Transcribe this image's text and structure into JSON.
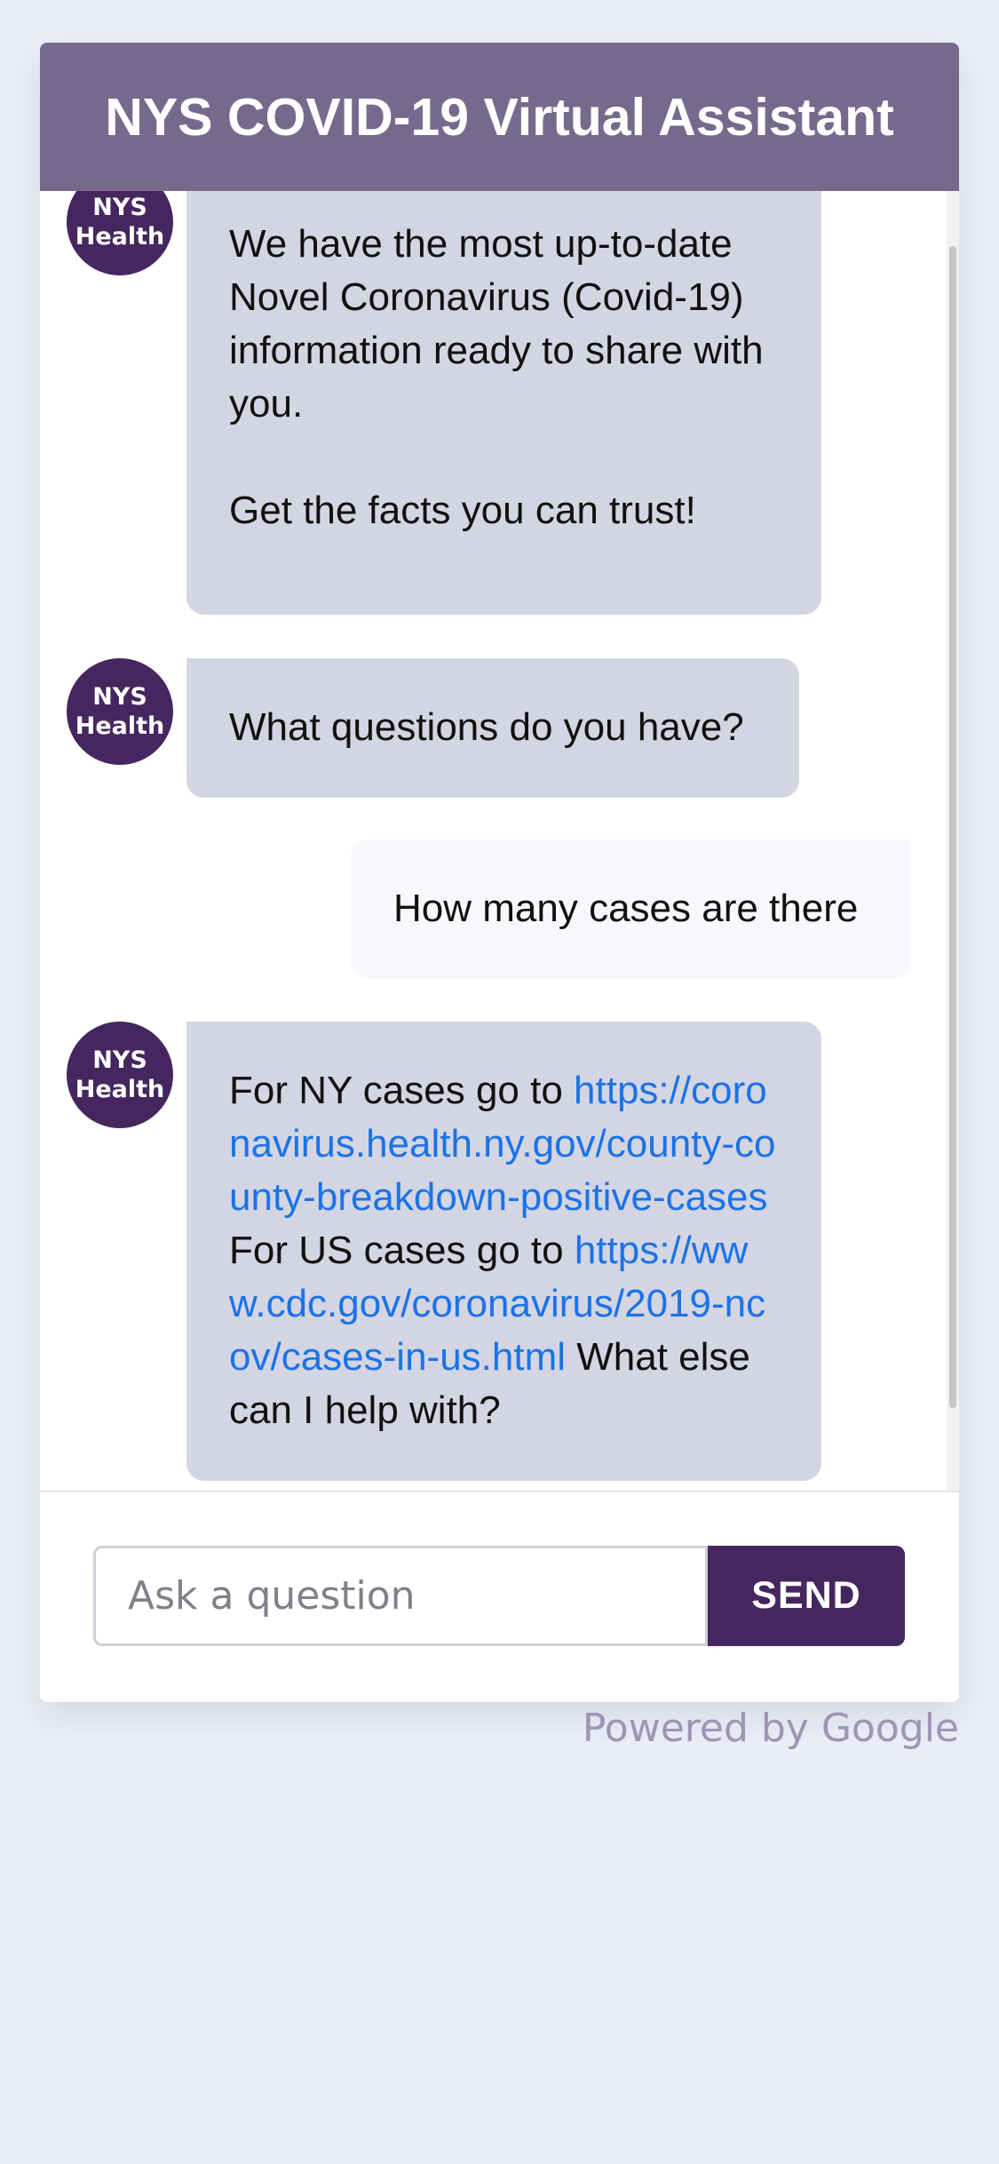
{
  "header": {
    "title": "NYS COVID-19 Virtual Assistant"
  },
  "avatar": {
    "line1": "NYS",
    "line2": "Health"
  },
  "messages": [
    {
      "from": "bot",
      "text1": "We have the most up-to-date Novel Coronavirus (Covid-19) information ready to share with you.",
      "text2": "Get the facts you can trust!"
    },
    {
      "from": "bot",
      "text": "What questions do you have?"
    },
    {
      "from": "user",
      "text": "How many cases are there"
    },
    {
      "from": "bot",
      "part1": "For NY cases go to ",
      "link1": "https://coronavirus.health.ny.gov/county-county-breakdown-positive-cases",
      "part2": " For US cases go to ",
      "link2": "https://www.cdc.gov/coronavirus/2019-ncov/cases-in-us.html",
      "part3": " What else can I help with?"
    }
  ],
  "input": {
    "placeholder": "Ask a question",
    "value": ""
  },
  "send_label": "SEND",
  "footer": {
    "powered_by": "Powered by Google"
  },
  "colors": {
    "header_bg": "#766a8c",
    "accent": "#45265e",
    "bot_bubble": "#d4d5e2",
    "user_bubble": "#f7f8fc",
    "link": "#1a73e8",
    "page_bg": "#ebeef7"
  }
}
